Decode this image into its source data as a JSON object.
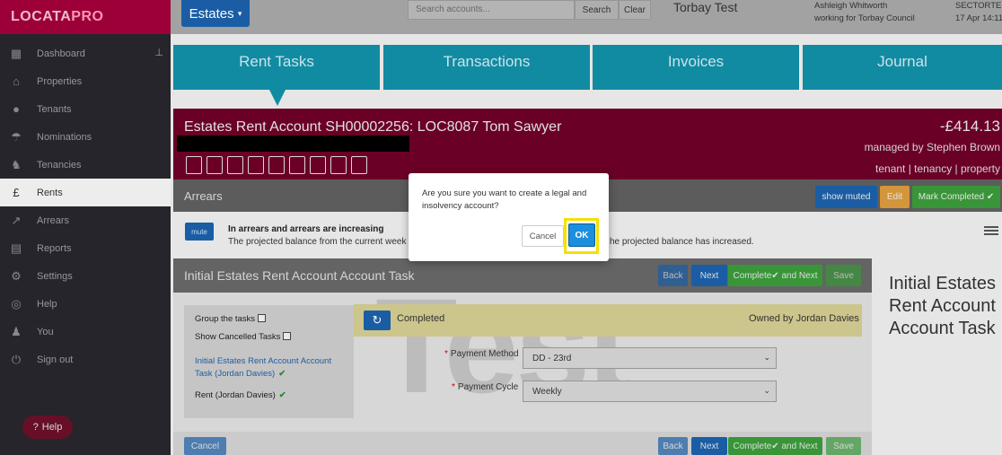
{
  "app": {
    "logo_part1": "LOCATA",
    "logo_part2": "PRO"
  },
  "sidebar": {
    "items": [
      {
        "label": "Dashboard",
        "icon": "grid-icon"
      },
      {
        "label": "Properties",
        "icon": "house-icon"
      },
      {
        "label": "Tenants",
        "icon": "people-icon"
      },
      {
        "label": "Nominations",
        "icon": "umbrella-icon"
      },
      {
        "label": "Tenancies",
        "icon": "tenancy-icon"
      },
      {
        "label": "Rents",
        "icon": "pound-icon"
      },
      {
        "label": "Arrears",
        "icon": "arrears-icon"
      },
      {
        "label": "Reports",
        "icon": "report-icon"
      },
      {
        "label": "Settings",
        "icon": "gear-icon"
      },
      {
        "label": "Help",
        "icon": "lifebuoy-icon"
      },
      {
        "label": "You",
        "icon": "user-icon"
      },
      {
        "label": "Sign out",
        "icon": "power-icon"
      }
    ],
    "help_label": "Help"
  },
  "topbar": {
    "module_label": "Estates",
    "search_placeholder": "Search accounts...",
    "search_button": "Search",
    "clear_button": "Clear",
    "title": "Torbay Test",
    "user_name": "Ashleigh Whitworth",
    "user_org": "working for Torbay Council",
    "org_code": "SECTORTES",
    "datetime": "17 Apr 14:11"
  },
  "tabs": [
    "Rent Tasks",
    "Transactions",
    "Invoices",
    "Journal"
  ],
  "account": {
    "title": "Estates Rent Account SH00002256: LOC8087 Tom Sawyer",
    "balance": "-£414.13",
    "managed_by": "managed by Stephen Brown",
    "links": "tenant | tenancy | property"
  },
  "arrears": {
    "label": "Arrears",
    "show_muted": "show muted",
    "edit": "Edit",
    "mark_completed": "Mark Completed",
    "mute": "mute",
    "title": "In arrears and arrears are increasing",
    "desc_start": "The projected balance from the current week is c",
    "desc_end": "he projected balance has increased."
  },
  "task": {
    "title": "Initial Estates Rent Account Account Task",
    "back": "Back",
    "next": "Next",
    "complete_next": "Complete✔ and Next",
    "save": "Save",
    "cancel": "Cancel",
    "group_tasks": "Group the tasks",
    "show_cancelled": "Show Cancelled Tasks",
    "task_link": "Initial Estates Rent Account Account Task (Jordan Davies)",
    "rent_task": "Rent (Jordan Davies)",
    "status": "Completed",
    "owned_by": "Owned by Jordan Davies",
    "payment_method_label": "Payment Method",
    "payment_method_value": "DD - 23rd",
    "payment_cycle_label": "Payment Cycle",
    "payment_cycle_value": "Weekly",
    "watermark": "Test",
    "side_title": "Initial Estates Rent Account Account Task"
  },
  "modal": {
    "message": "Are you sure you want to create a legal and insolvency account?",
    "cancel": "Cancel",
    "ok": "OK"
  }
}
